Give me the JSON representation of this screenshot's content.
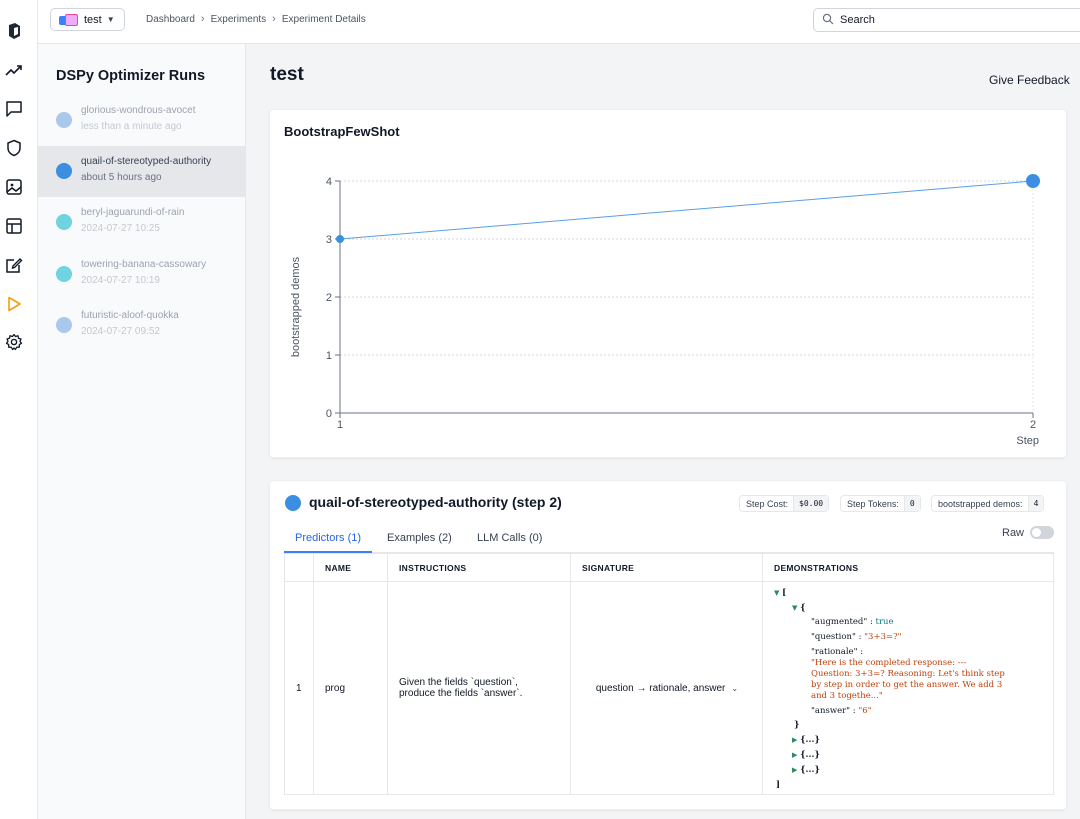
{
  "topbar": {
    "project": "test",
    "breadcrumbs": [
      "Dashboard",
      "Experiments",
      "Experiment Details"
    ],
    "search_placeholder": "Search"
  },
  "sidebar": {
    "title": "DSPy Optimizer Runs",
    "runs": [
      {
        "name": "glorious-wondrous-avocet",
        "time": "less than a minute ago",
        "color": "#a9c8ec",
        "selected": false
      },
      {
        "name": "quail-of-stereotyped-authority",
        "time": "about 5 hours ago",
        "color": "#3b8ee0",
        "selected": true
      },
      {
        "name": "beryl-jaguarundi-of-rain",
        "time": "2024-07-27 10:25",
        "color": "#6fd3e0",
        "selected": false
      },
      {
        "name": "towering-banana-cassowary",
        "time": "2024-07-27 10:19",
        "color": "#6fd3e0",
        "selected": false
      },
      {
        "name": "futuristic-aloof-quokka",
        "time": "2024-07-27 09:52",
        "color": "#a9c8ec",
        "selected": false
      }
    ]
  },
  "main": {
    "title": "test",
    "feedback": "Give Feedback"
  },
  "chart_data": {
    "type": "line",
    "title": "BootstrapFewShot",
    "xlabel": "Step",
    "ylabel": "bootstrapped demos",
    "x": [
      1,
      2
    ],
    "series": [
      {
        "values": [
          3,
          4
        ],
        "color": "#3b8ee0"
      }
    ],
    "xlim": [
      1,
      2
    ],
    "ylim": [
      0,
      4
    ],
    "yticks": [
      0,
      1,
      2,
      3,
      4
    ],
    "xticks": [
      1,
      2
    ],
    "grid": true
  },
  "step": {
    "title": "quail-of-stereotyped-authority (step 2)",
    "stats": [
      {
        "label": "Step Cost:",
        "value": "$0.00"
      },
      {
        "label": "Step Tokens:",
        "value": "0"
      },
      {
        "label": "bootstrapped demos:",
        "value": "4"
      }
    ],
    "raw_label": "Raw",
    "tabs": [
      "Predictors (1)",
      "Examples (2)",
      "LLM Calls (0)"
    ],
    "table": {
      "headers": [
        "",
        "NAME",
        "INSTRUCTIONS",
        "SIGNATURE",
        "DEMONSTRATIONS"
      ],
      "row": {
        "index": "1",
        "name": "prog",
        "instructions_1": "Given the fields `question`,",
        "instructions_2": "produce the fields `answer`.",
        "signature": "question → rationale, answer"
      }
    },
    "demo": {
      "open_bracket": "[",
      "open_brace": "{",
      "augmented_key": "\"augmented\"",
      "augmented_val": "true",
      "question_key": "\"question\"",
      "question_val": "\"3+3=?\"",
      "rationale_key": "\"rationale\"",
      "rationale_1": "\"Here is the completed response: ---",
      "rationale_2": "Question: 3+3=? Reasoning: Let's think step",
      "rationale_3": "by step in order to get the answer. We add 3",
      "rationale_4": "and 3 togethe...\"",
      "answer_key": "\"answer\"",
      "answer_val": "\"6\"",
      "close_brace": "}",
      "collapsed": "{...}",
      "close_bracket": "]",
      "colon": ":"
    }
  }
}
